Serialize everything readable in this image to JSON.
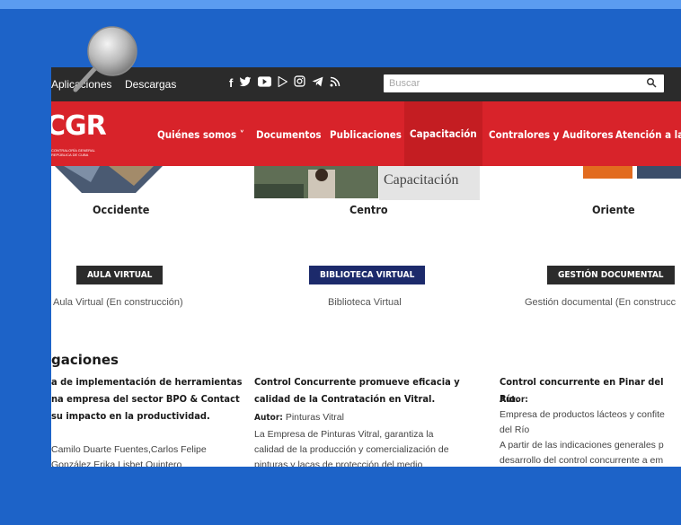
{
  "topbar": {
    "links": [
      "Aplicaciones",
      "Descargas"
    ],
    "social_icons": [
      "facebook-icon",
      "twitter-icon",
      "youtube-icon",
      "play-icon",
      "instagram-icon",
      "telegram-icon",
      "rss-icon"
    ],
    "search_placeholder": "Buscar"
  },
  "nav": {
    "logo": "CGR",
    "logo_sub": "CONTRALORÍA GENERAL\nREPÚBLICA DE CUBA",
    "items": [
      "Quiénes somos ˅",
      "Documentos",
      "Publicaciones",
      "Capacitación",
      "Contralores y Auditores",
      "Atención a la"
    ],
    "active_index": 3
  },
  "regions": [
    "Occidente",
    "Centro",
    "Oriente"
  ],
  "overlay_text": "Capacitación",
  "overlay_text_2": "Capacitación",
  "services": [
    {
      "label": "AULA VIRTUAL",
      "caption": "Aula Virtual (En construcción)"
    },
    {
      "label": "BIBLIOTECA VIRTUAL",
      "caption": "Biblioteca Virtual"
    },
    {
      "label": "GESTIÓN DOCUMENTAL",
      "caption": "Gestión documental (En construcc"
    }
  ],
  "section_heading": "gaciones",
  "articles": [
    {
      "title_lines": [
        "a de implementación de herramientas",
        "na empresa del sector BPO & Contact",
        "su impacto en la productividad."
      ],
      "autor_label": "",
      "autor_value": "",
      "body_lines": [
        "Camilo Duarte Fuentes,Carlos Felipe",
        "González Erika Lisbet Quintero"
      ]
    },
    {
      "title_lines": [
        "Control Concurrente promueve eficacia y",
        "calidad de la Contratación en Vitral."
      ],
      "autor_label": "Autor:",
      "autor_value": "Pinturas Vitral",
      "body_lines": [
        "La Empresa de Pinturas Vitral, garantiza la",
        "calidad de la producción y comercialización de",
        "pinturas y lacas de protección del medio"
      ]
    },
    {
      "title_lines": [
        "Control concurrente en Pinar del Río."
      ],
      "autor_label": "Autor:",
      "autor_value": "",
      "body_lines": [
        "Empresa de productos lácteos y confite",
        "del Río",
        "A partir de las indicaciones generales p",
        "desarrollo del control concurrente a em"
      ]
    }
  ],
  "colors": {
    "background": "#1d63c8",
    "topbar": "#2b2b2b",
    "nav_red": "#d8232a",
    "button_dark": "#2b2b2b",
    "button_navy": "#1c2a6b"
  }
}
